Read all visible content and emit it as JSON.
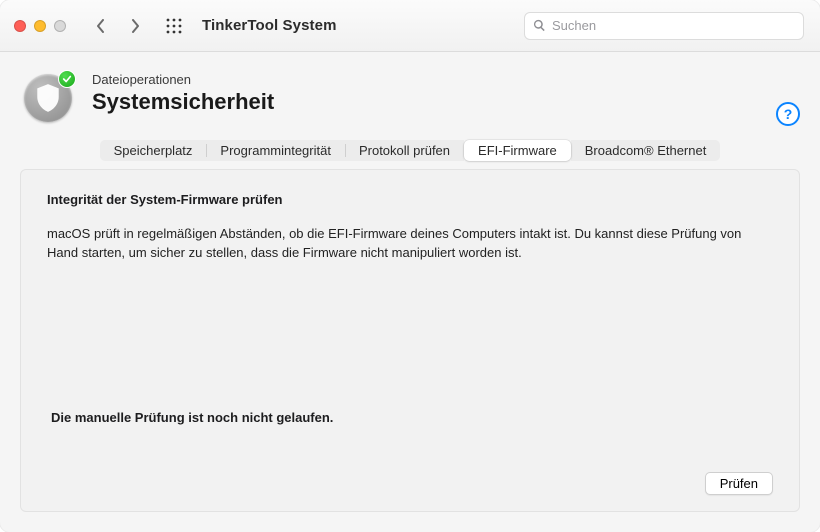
{
  "toolbar": {
    "app_title": "TinkerTool System",
    "search_placeholder": "Suchen"
  },
  "header": {
    "breadcrumb": "Dateioperationen",
    "page_title": "Systemsicherheit",
    "help_label": "?"
  },
  "tabs": [
    {
      "label": "Speicherplatz",
      "active": false
    },
    {
      "label": "Programmintegrität",
      "active": false
    },
    {
      "label": "Protokoll prüfen",
      "active": false
    },
    {
      "label": "EFI-Firmware",
      "active": true
    },
    {
      "label": "Broadcom® Ethernet",
      "active": false
    }
  ],
  "panel": {
    "section_title": "Integrität der System-Firmware prüfen",
    "section_body": "macOS prüft in regelmäßigen Abständen, ob die EFI-Firmware deines Computers intakt ist. Du kannst diese Prüfung von Hand starten, um sicher zu stellen, dass die Firmware nicht manipuliert worden ist.",
    "status": "Die manuelle Prüfung ist noch nicht gelaufen.",
    "check_button": "Prüfen"
  }
}
